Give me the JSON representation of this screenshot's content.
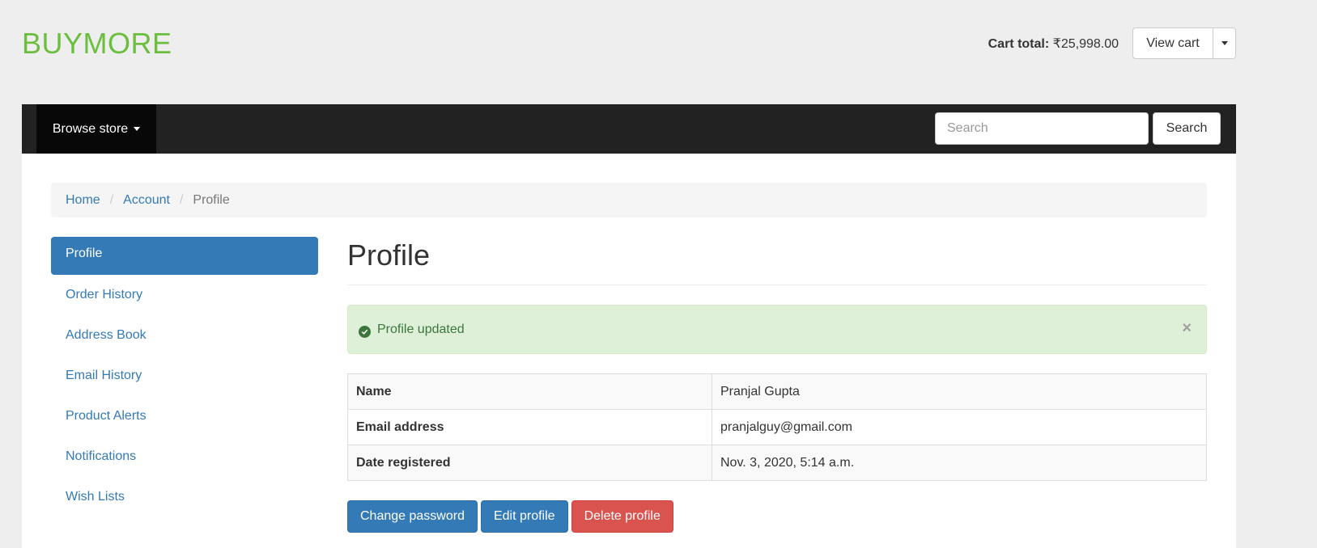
{
  "brand": "BUYMORE",
  "cart": {
    "total_label": "Cart total:",
    "total_value": "₹25,998.00",
    "view_cart": "View cart"
  },
  "navbar": {
    "browse_label": "Browse store",
    "search_placeholder": "Search",
    "search_button": "Search"
  },
  "breadcrumb": [
    "Home",
    "Account",
    "Profile"
  ],
  "sidebar": {
    "items": [
      {
        "label": "Profile",
        "active": true
      },
      {
        "label": "Order History"
      },
      {
        "label": "Address Book"
      },
      {
        "label": "Email History"
      },
      {
        "label": "Product Alerts"
      },
      {
        "label": "Notifications"
      },
      {
        "label": "Wish Lists"
      }
    ]
  },
  "main": {
    "title": "Profile",
    "alert": {
      "message": "Profile updated",
      "close": "×"
    },
    "table": [
      {
        "label": "Name",
        "value": "Pranjal Gupta"
      },
      {
        "label": "Email address",
        "value": "pranjalguy@gmail.com"
      },
      {
        "label": "Date registered",
        "value": "Nov. 3, 2020, 5:14 a.m."
      }
    ],
    "actions": {
      "change_password": "Change password",
      "edit_profile": "Edit profile",
      "delete_profile": "Delete profile"
    }
  },
  "colors": {
    "brand": "#6cbe3f",
    "primary": "#337ab7",
    "danger": "#d9534f",
    "navbar": "#222222",
    "success_bg": "#dff0d8"
  }
}
